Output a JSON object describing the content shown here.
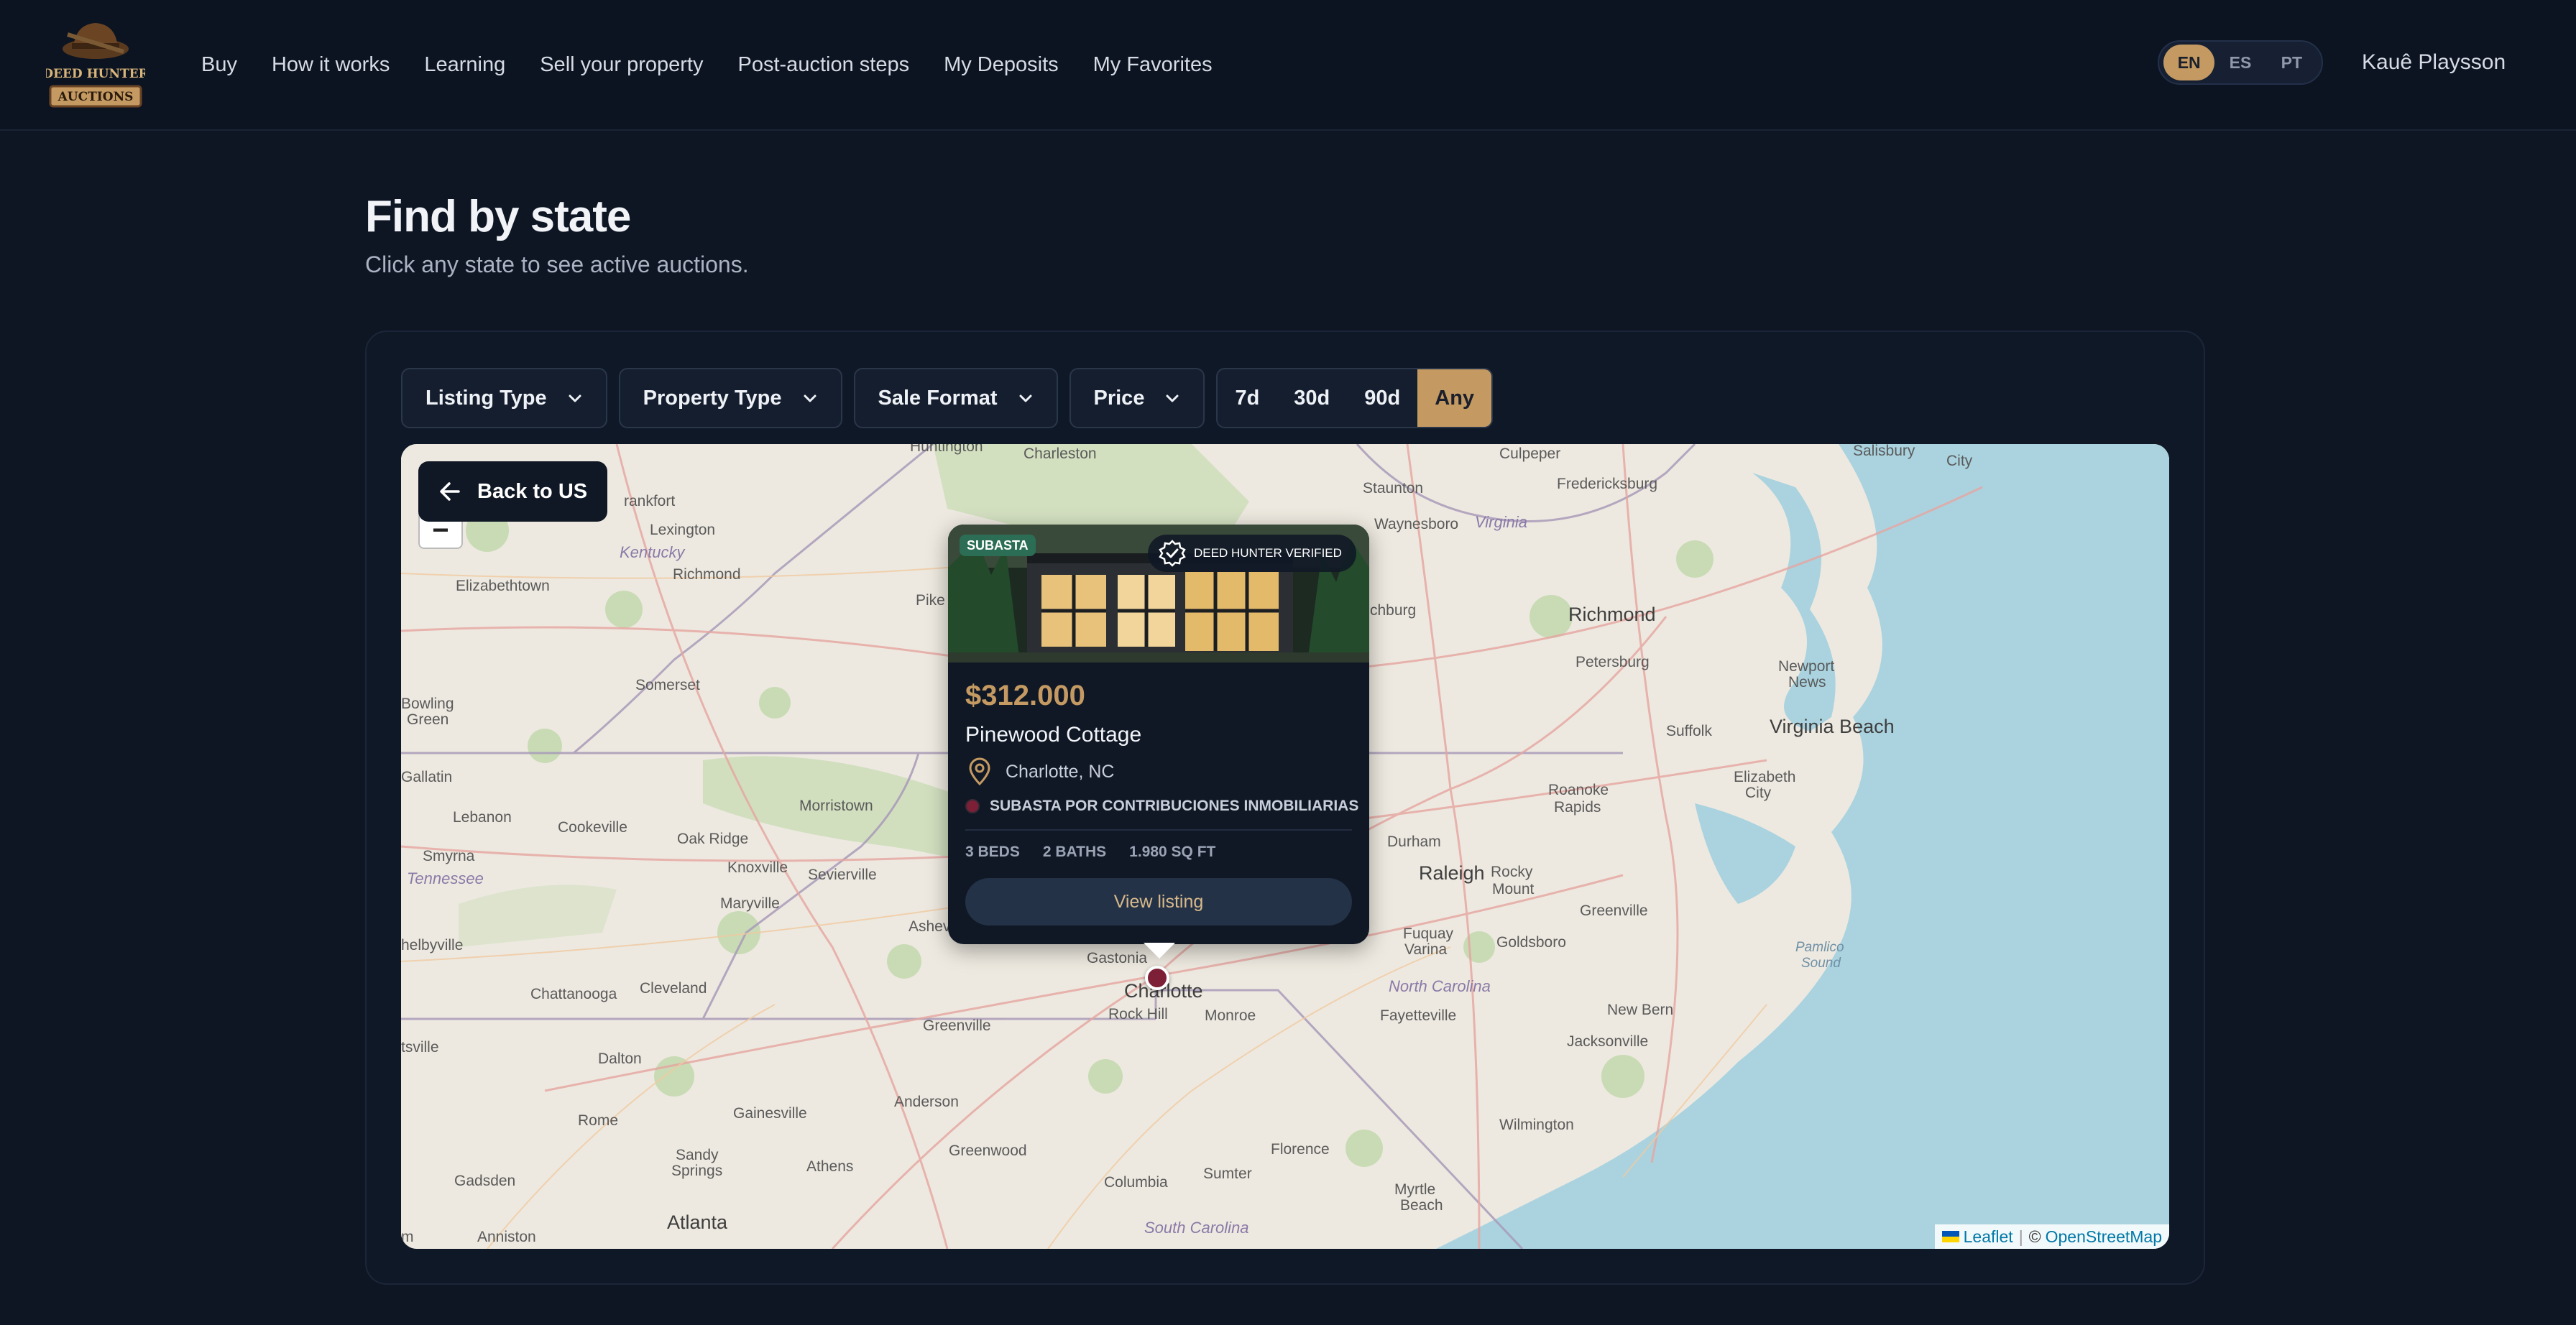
{
  "header": {
    "logo_text_top": "DEED HUNTER",
    "logo_text_bottom": "AUCTIONS",
    "nav": [
      "Buy",
      "How it works",
      "Learning",
      "Sell your property",
      "Post-auction steps",
      "My Deposits",
      "My Favorites"
    ],
    "languages": [
      "EN",
      "ES",
      "PT"
    ],
    "active_language": "EN",
    "user_name": "Kauê Playsson"
  },
  "page": {
    "title": "Find by state",
    "subtitle": "Click any state to see active auctions."
  },
  "filters": {
    "listing_type": "Listing Type",
    "property_type": "Property Type",
    "sale_format": "Sale Format",
    "price": "Price",
    "ranges": [
      "7d",
      "30d",
      "90d",
      "Any"
    ],
    "active_range": "Any"
  },
  "map": {
    "back_label": "Back to US",
    "zoom_out": "−",
    "attribution_leaflet": "Leaflet",
    "attribution_sep": "|",
    "attribution_copy": "©",
    "attribution_osm": "OpenStreetMap",
    "labels": {
      "huntington": "Huntington",
      "charleston": "Charleston",
      "staunton": "Staunton",
      "culpeper": "Culpeper",
      "fredericksburg": "Fredericksburg",
      "salisbury": "Salisbury",
      "city": "City",
      "frankfort": "rankfort",
      "lexington": "Lexington",
      "waynesboro": "Waynesboro",
      "virginia": "Virginia",
      "kentucky": "Kentucky",
      "richmond_ky": "Richmond",
      "elizabethtown": "Elizabethtown",
      "pike": "Pike",
      "lynchburg": "chburg",
      "richmond_va": "Richmond",
      "petersburg": "Petersburg",
      "newport": "Newport",
      "news": "News",
      "somerset": "Somerset",
      "bowling": "Bowling",
      "green": "Green",
      "suffolk": "Suffolk",
      "virginia_beach": "Virginia Beach",
      "gallatin": "Gallatin",
      "lebanon": "Lebanon",
      "morristown": "Morristown",
      "roanoke": "Roanoke",
      "rapids": "Rapids",
      "elizabeth": "Elizabeth",
      "elizabeth_city": "City",
      "cookeville": "Cookeville",
      "oak_ridge": "Oak Ridge",
      "durham": "Durham",
      "smyrna": "Smyrna",
      "knoxville": "Knoxville",
      "sevierville": "Sevierville",
      "raleigh": "Raleigh",
      "tennessee": "Tennessee",
      "rocky": "Rocky",
      "mount": "Mount",
      "maryville": "Maryville",
      "asheville": "Ashev",
      "greenville_nc": "Greenville",
      "shelbyville": "helbyville",
      "fuquay": "Fuquay",
      "varina": "Varina",
      "goldsboro": "Goldsboro",
      "pamlico": "Pamlico",
      "sound": "Sound",
      "chattanooga": "Chattanooga",
      "cleveland": "Cleveland",
      "gastonia": "Gastonia",
      "charlotte": "Charlotte",
      "north_carolina": "North Carolina",
      "new_bern": "New Bern",
      "rock_hill": "Rock Hill",
      "monroe": "Monroe",
      "greenville_sc": "Greenville",
      "fayetteville": "Fayetteville",
      "jacksonville": "Jacksonville",
      "fayetteville_tn": "tsville",
      "dalton": "Dalton",
      "rome": "Rome",
      "gainesville": "Gainesville",
      "anderson": "Anderson",
      "wilmington": "Wilmington",
      "greenwood": "Greenwood",
      "florence": "Florence",
      "athens": "Athens",
      "sandy": "Sandy",
      "springs": "Springs",
      "gadsden": "Gadsden",
      "columbia": "Columbia",
      "sumter": "Sumter",
      "myrtle": "Myrtle",
      "beach": "Beach",
      "atlanta": "Atlanta",
      "anniston": "Anniston",
      "south_carolina": "South Carolina",
      "birmingham": "m"
    }
  },
  "listing": {
    "badge": "SUBASTA",
    "verified": "DEED HUNTER VERIFIED",
    "price": "$312.000",
    "title": "Pinewood Cottage",
    "location": "Charlotte, NC",
    "type": "SUBASTA POR CONTRIBUCIONES INMOBILIARIAS",
    "beds": "3 BEDS",
    "baths": "2 BATHS",
    "sqft": "1.980 SQ FT",
    "cta": "View listing"
  },
  "colors": {
    "accent": "#c49a62",
    "marker": "#7d1f36",
    "background": "#0e1624"
  }
}
